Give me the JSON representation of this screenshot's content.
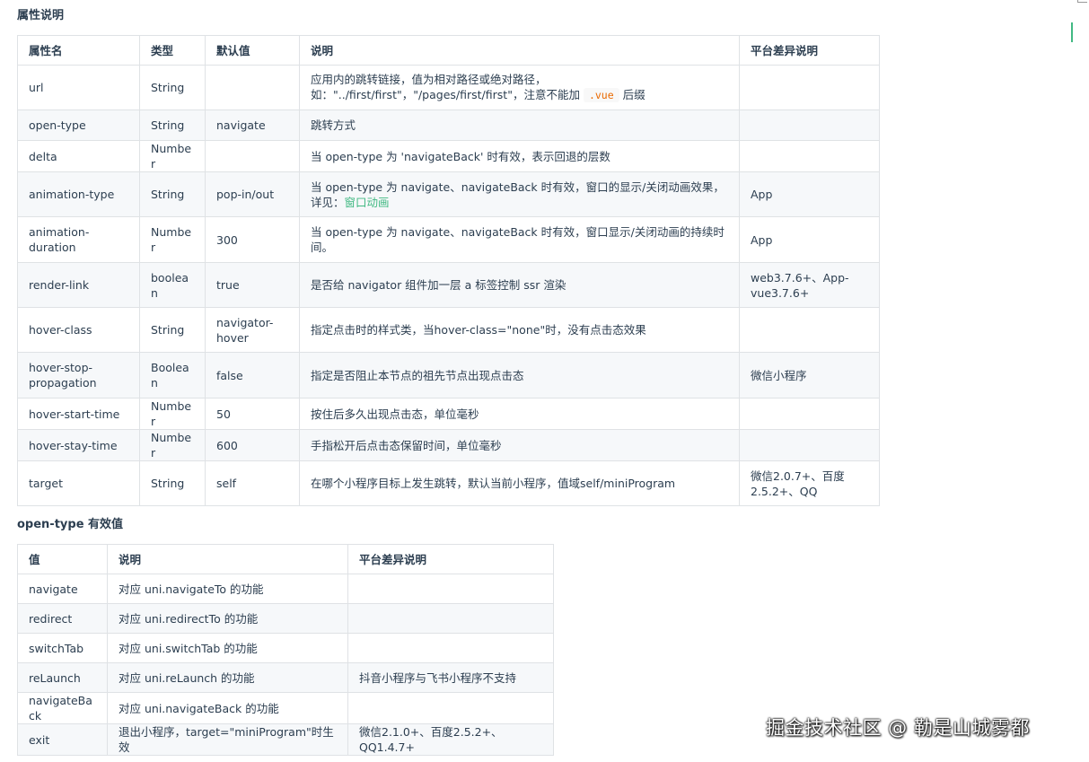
{
  "titles": {
    "props": "属性说明",
    "open_type": "open-type 有效值"
  },
  "props_table": {
    "headers": [
      "属性名",
      "类型",
      "默认值",
      "说明",
      "平台差异说明"
    ],
    "rows": [
      {
        "name": "url",
        "type": "String",
        "default": "",
        "desc_line1": "应用内的跳转链接，值为相对路径或绝对路径，",
        "desc_line2_pre": "如：\"../first/first\"，\"/pages/first/first\"，注意不能加",
        "desc_code": ".vue",
        "desc_line2_post": "后缀",
        "platform": ""
      },
      {
        "name": "open-type",
        "type": "String",
        "default": "navigate",
        "desc": "跳转方式",
        "platform": ""
      },
      {
        "name": "delta",
        "type": "Number",
        "default": "",
        "desc": "当 open-type 为 'navigateBack' 时有效，表示回退的层数",
        "platform": ""
      },
      {
        "name": "animation-type",
        "type": "String",
        "default": "pop-in/out",
        "desc_pre": "当 open-type 为 navigate、navigateBack 时有效，窗口的显示/关闭动画效果，详见：",
        "desc_link": "窗口动画",
        "platform": "App"
      },
      {
        "name": "animation-duration",
        "type": "Number",
        "default": "300",
        "desc": "当 open-type 为 navigate、navigateBack 时有效，窗口显示/关闭动画的持续时间。",
        "platform": "App"
      },
      {
        "name": "render-link",
        "type": "boolean",
        "default": "true",
        "desc": "是否给 navigator 组件加一层 a 标签控制 ssr 渲染",
        "platform": "web3.7.6+、App-vue3.7.6+"
      },
      {
        "name": "hover-class",
        "type": "String",
        "default": "navigator-hover",
        "desc": "指定点击时的样式类，当hover-class=\"none\"时，没有点击态效果",
        "platform": ""
      },
      {
        "name": "hover-stop-propagation",
        "type": "Boolean",
        "default": "false",
        "desc": "指定是否阻止本节点的祖先节点出现点击态",
        "platform": "微信小程序"
      },
      {
        "name": "hover-start-time",
        "type": "Number",
        "default": "50",
        "desc": "按住后多久出现点击态，单位毫秒",
        "platform": ""
      },
      {
        "name": "hover-stay-time",
        "type": "Number",
        "default": "600",
        "desc": "手指松开后点击态保留时间，单位毫秒",
        "platform": ""
      },
      {
        "name": "target",
        "type": "String",
        "default": "self",
        "desc": "在哪个小程序目标上发生跳转，默认当前小程序，值域self/miniProgram",
        "platform": "微信2.0.7+、百度2.5.2+、QQ"
      }
    ]
  },
  "open_type_table": {
    "headers": [
      "值",
      "说明",
      "平台差异说明"
    ],
    "rows": [
      {
        "value": "navigate",
        "desc": "对应 uni.navigateTo 的功能",
        "platform": ""
      },
      {
        "value": "redirect",
        "desc": "对应 uni.redirectTo 的功能",
        "platform": ""
      },
      {
        "value": "switchTab",
        "desc": "对应 uni.switchTab 的功能",
        "platform": ""
      },
      {
        "value": "reLaunch",
        "desc": "对应 uni.reLaunch 的功能",
        "platform": "抖音小程序与飞书小程序不支持"
      },
      {
        "value": "navigateBack",
        "desc": "对应 uni.navigateBack 的功能",
        "platform": ""
      },
      {
        "value": "exit",
        "desc": "退出小程序，target=\"miniProgram\"时生效",
        "platform": "微信2.1.0+、百度2.5.2+、QQ1.4.7+"
      }
    ]
  },
  "watermark": "掘金技术社区 @ 勒是山城雾都",
  "colors": {
    "link": "#42b983",
    "code": "#e96900",
    "border": "#dfe2e5",
    "row_alt": "#f6f8fa",
    "text": "#2c3e50"
  }
}
